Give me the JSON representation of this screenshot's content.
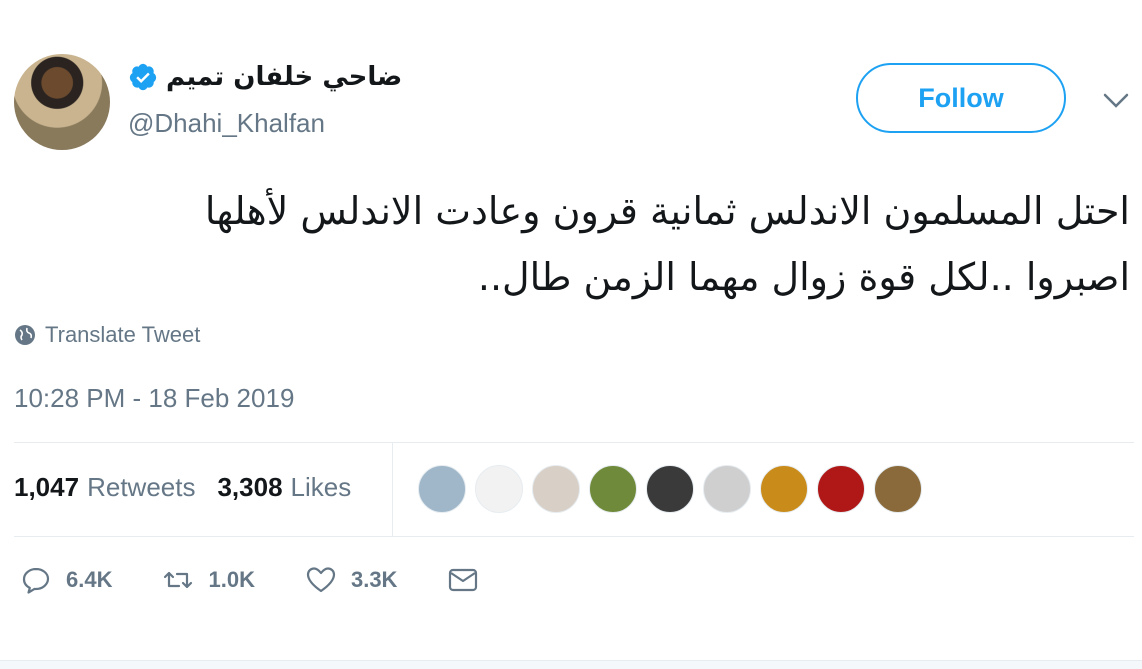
{
  "author": {
    "display_name": "ضاحي خلفان تميم",
    "handle": "@Dhahi_Khalfan",
    "verified": true
  },
  "follow_button": {
    "label": "Follow"
  },
  "tweet": {
    "text_line1": "احتل المسلمون الاندلس ثمانية قرون وعادت الاندلس لأهلها",
    "text_line2": "اصبروا ..لكل قوة زوال مهما الزمن طال..",
    "translate_label": "Translate Tweet",
    "timestamp": "10:28 PM - 18 Feb 2019"
  },
  "stats": {
    "retweets_count": "1,047",
    "retweets_label": "Retweets",
    "likes_count": "3,308",
    "likes_label": "Likes"
  },
  "liker_avatars": [
    {
      "color": "#9fb7c9"
    },
    {
      "color": "#f2f2f2"
    },
    {
      "color": "#d8cfc6"
    },
    {
      "color": "#6f8a3a"
    },
    {
      "color": "#3a3a3a"
    },
    {
      "color": "#cfcfcf"
    },
    {
      "color": "#c98b1a"
    },
    {
      "color": "#b01818"
    },
    {
      "color": "#8a6a3a"
    }
  ],
  "actions": {
    "replies": "6.4K",
    "retweets": "1.0K",
    "likes": "3.3K"
  },
  "colors": {
    "accent": "#1da1f2",
    "secondary_text": "#657786",
    "primary_text": "#14171a"
  }
}
